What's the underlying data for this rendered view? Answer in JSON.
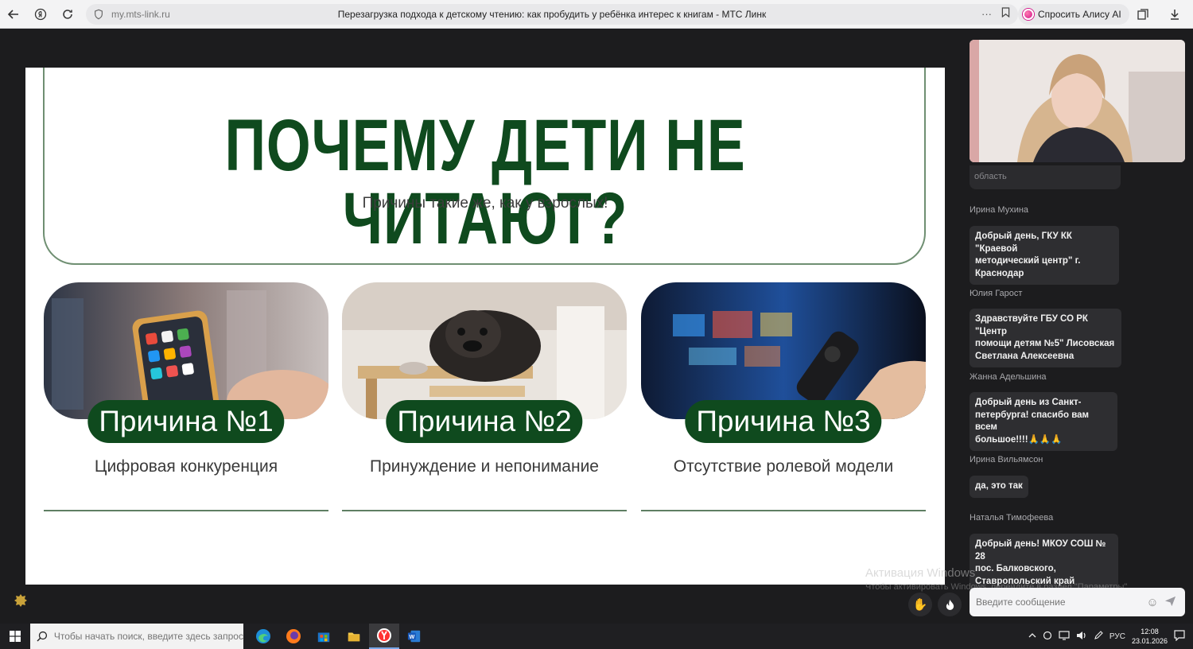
{
  "browser": {
    "url": "my.mts-link.ru",
    "page_title": "Перезагрузка подхода к детскому чтению: как пробудить у ребёнка интерес к книгам - МТС Линк",
    "alice_label": "Спросить Алису AI"
  },
  "slide": {
    "title": "ПОЧЕМУ ДЕТИ НЕ ЧИТАЮТ?",
    "subtitle": "Причины такие же, как у взрослых!",
    "cards": [
      {
        "badge": "Причина  №1",
        "desc": "Цифровая конкуренция"
      },
      {
        "badge": "Причина №2",
        "desc": "Принуждение и непонимание"
      },
      {
        "badge": "Причина №3",
        "desc": "Отсутствие ролевой модели"
      }
    ]
  },
  "chat": {
    "partial_text": "область",
    "messages": [
      {
        "author": "Ирина Мухина",
        "lines": [
          "Добрый день,  ГКУ КК \"Краевой",
          "методический центр\" г.",
          "Краснодар"
        ]
      },
      {
        "author": "Юлия Гарост",
        "lines": [
          "Здравствуйте ГБУ СО РК \"Центр",
          "помощи детям №5\" Лисовская",
          "Светлана Алексеевна"
        ]
      },
      {
        "author": "Жанна Адельшина",
        "lines": [
          "Добрый день из Санкт-",
          "петербурга! спасибо вам всем",
          "большое!!!!🙏🙏🙏"
        ]
      },
      {
        "author": "Ирина Вильямсон",
        "lines": [
          "да, это так"
        ]
      },
      {
        "author": "Наталья Тимофеева",
        "lines": [
          "Добрый день! МКОУ СОШ № 28",
          "пос. Балковского,",
          "Ставропольский край"
        ]
      }
    ],
    "input_placeholder": "Введите сообщение"
  },
  "watermark": {
    "line1": "Активация Windows",
    "line2": "Чтобы активировать Windows, перейдите в раздел \"Параметры\"."
  },
  "taskbar": {
    "search_placeholder": "Чтобы начать поиск, введите здесь запрос",
    "lang": "РУС",
    "time": "12:08",
    "date": "23.01.2026"
  }
}
